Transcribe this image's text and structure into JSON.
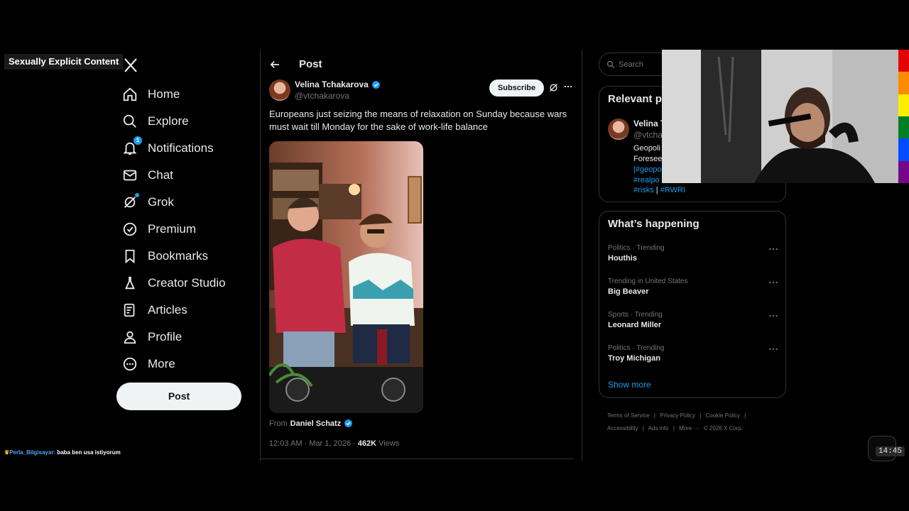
{
  "overlay": {
    "content_warning": "Sexually Explicit Content",
    "chat": {
      "user": "Perla_Bilgisayar:",
      "message": " baba ben usa istiyorum"
    }
  },
  "nav": {
    "items": [
      {
        "label": "Home",
        "icon": "home-icon"
      },
      {
        "label": "Explore",
        "icon": "search-icon"
      },
      {
        "label": "Notifications",
        "icon": "bell-icon",
        "badge": "1"
      },
      {
        "label": "Chat",
        "icon": "mail-icon"
      },
      {
        "label": "Grok",
        "icon": "grok-icon"
      },
      {
        "label": "Premium",
        "icon": "premium-icon"
      },
      {
        "label": "Bookmarks",
        "icon": "bookmark-icon"
      },
      {
        "label": "Creator Studio",
        "icon": "flask-icon"
      },
      {
        "label": "Articles",
        "icon": "article-icon"
      },
      {
        "label": "Profile",
        "icon": "person-icon"
      },
      {
        "label": "More",
        "icon": "more-circle-icon"
      }
    ],
    "post_button": "Post"
  },
  "post": {
    "header_title": "Post",
    "author_name": "Velina Tchakarova",
    "author_handle": "@vtchakarova",
    "subscribe_label": "Subscribe",
    "text": "Europeans just seizing the means of relaxation on Sunday because wars must wait till Monday for the sake of work-life balance",
    "from_prefix": "From",
    "from_name": "Daniel Schatz",
    "timestamp": "12:03 AM · Mar 1, 2026 · ",
    "views_count": "462K",
    "views_label": " Views"
  },
  "sidebar": {
    "search_placeholder": "Search",
    "relevant": {
      "title": "Relevant p",
      "name": "Velina T",
      "handle": "@vtchal",
      "bio_lines": [
        "Geopoli",
        "Foresee",
        "|#geopo",
        "#realpo"
      ],
      "tag_line": {
        "first": "#risks",
        "sep": " | ",
        "second": "#RWRI"
      }
    },
    "trends_title": "What’s happening",
    "trends": [
      {
        "category": "Politics · Trending",
        "name": "Houthis"
      },
      {
        "category": "Trending in United States",
        "name": "Big Beaver"
      },
      {
        "category": "Sports · Trending",
        "name": "Leonard Miller"
      },
      {
        "category": "Politics · Trending",
        "name": "Troy Michigan"
      }
    ],
    "show_more": "Show more",
    "footer_links": [
      "Terms of Service",
      "|",
      "Privacy Policy",
      "|",
      "Cookie Policy",
      "|",
      "Accessibility",
      "|",
      "Ads info",
      "|",
      "More ···",
      "© 2026 X Corp."
    ]
  },
  "timer": "14:45",
  "colors": {
    "accent": "#1d9bf0",
    "background": "#000000",
    "rainbow": [
      "#e40303",
      "#ff8c00",
      "#ffed00",
      "#008026",
      "#004dff",
      "#750787"
    ]
  }
}
